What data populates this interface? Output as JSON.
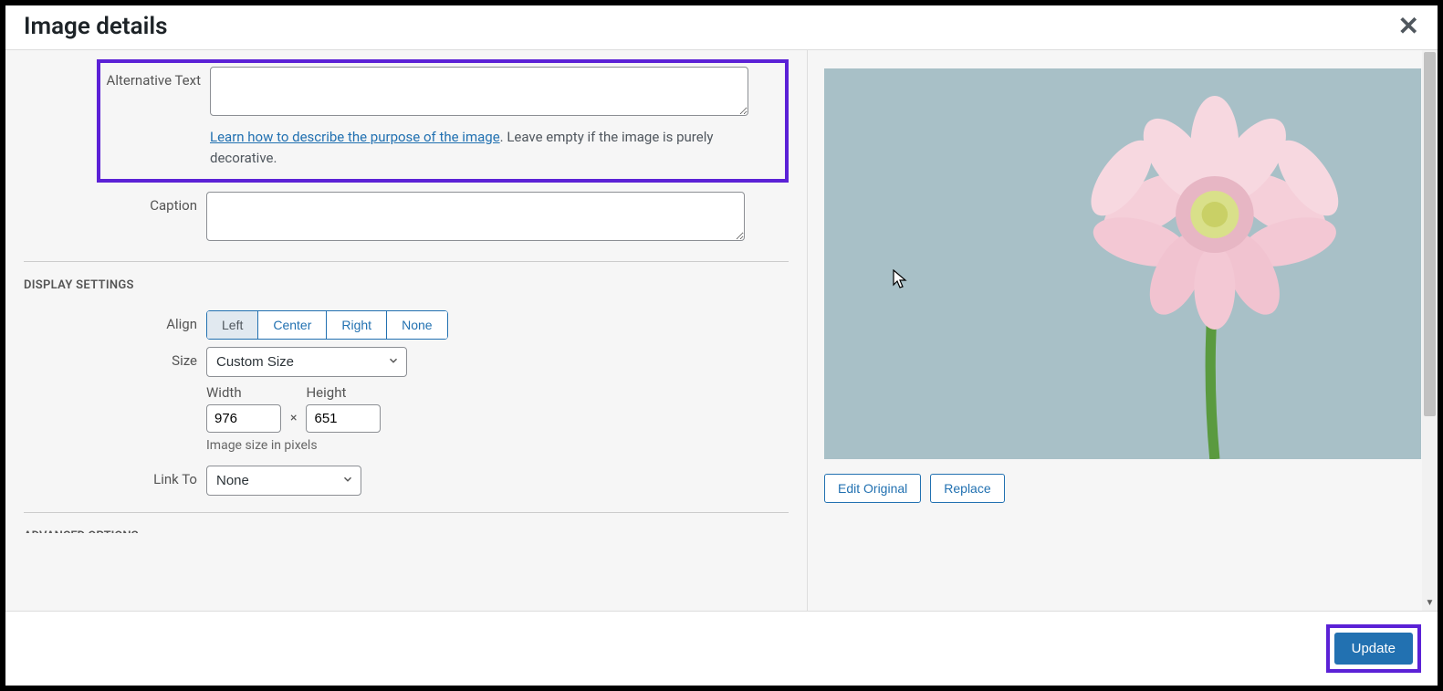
{
  "modal": {
    "title": "Image details",
    "close_label": "✕"
  },
  "fields": {
    "alt_text": {
      "label": "Alternative Text",
      "value": "",
      "help_link_text": "Learn how to describe the purpose of the image",
      "help_suffix": ". Leave empty if the image is purely decorative."
    },
    "caption": {
      "label": "Caption",
      "value": ""
    }
  },
  "display_settings": {
    "heading": "DISPLAY SETTINGS",
    "align": {
      "label": "Align",
      "options": {
        "left": "Left",
        "center": "Center",
        "right": "Right",
        "none": "None"
      },
      "selected": "left"
    },
    "size": {
      "label": "Size",
      "selected": "Custom Size"
    },
    "width": {
      "label": "Width",
      "value": "976"
    },
    "height": {
      "label": "Height",
      "value": "651"
    },
    "dim_separator": "×",
    "dim_hint": "Image size in pixels",
    "link_to": {
      "label": "Link To",
      "selected": "None"
    }
  },
  "advanced": {
    "heading": "ADVANCED OPTIONS"
  },
  "preview": {
    "edit_original_label": "Edit Original",
    "replace_label": "Replace"
  },
  "footer": {
    "update_label": "Update"
  }
}
